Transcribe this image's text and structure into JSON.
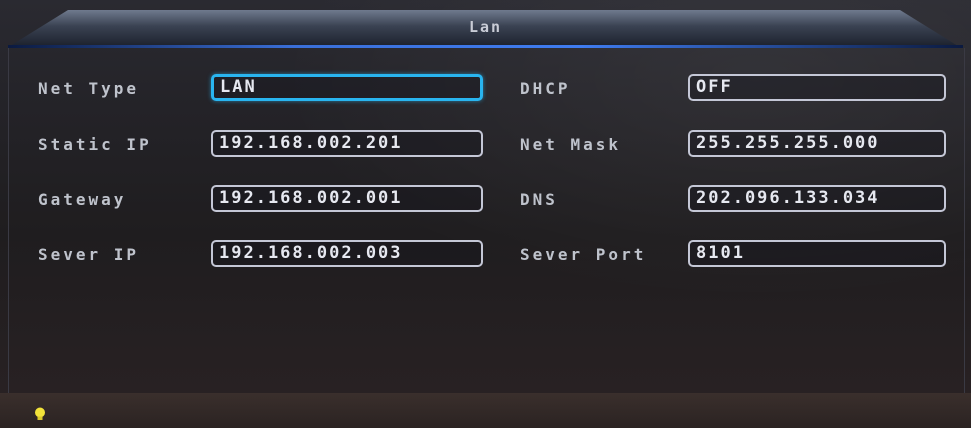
{
  "window": {
    "title": "Lan"
  },
  "fields": {
    "net_type": {
      "label": "Net Type",
      "value": "LAN"
    },
    "dhcp": {
      "label": "DHCP",
      "value": "OFF"
    },
    "static_ip": {
      "label": "Static IP",
      "value": "192.168.002.201"
    },
    "net_mask": {
      "label": "Net Mask",
      "value": "255.255.255.000"
    },
    "gateway": {
      "label": "Gateway",
      "value": "192.168.002.001"
    },
    "dns": {
      "label": "DNS",
      "value": "202.096.133.034"
    },
    "sever_ip": {
      "label": "Sever IP",
      "value": "192.168.002.003"
    },
    "sever_port": {
      "label": "Sever Port",
      "value": "8101"
    }
  },
  "status": {
    "icon": "lightbulb-icon"
  },
  "colors": {
    "focus": "#29b5f0",
    "field_border": "#c4c7d6",
    "title_accent": "#3f7cf0"
  }
}
